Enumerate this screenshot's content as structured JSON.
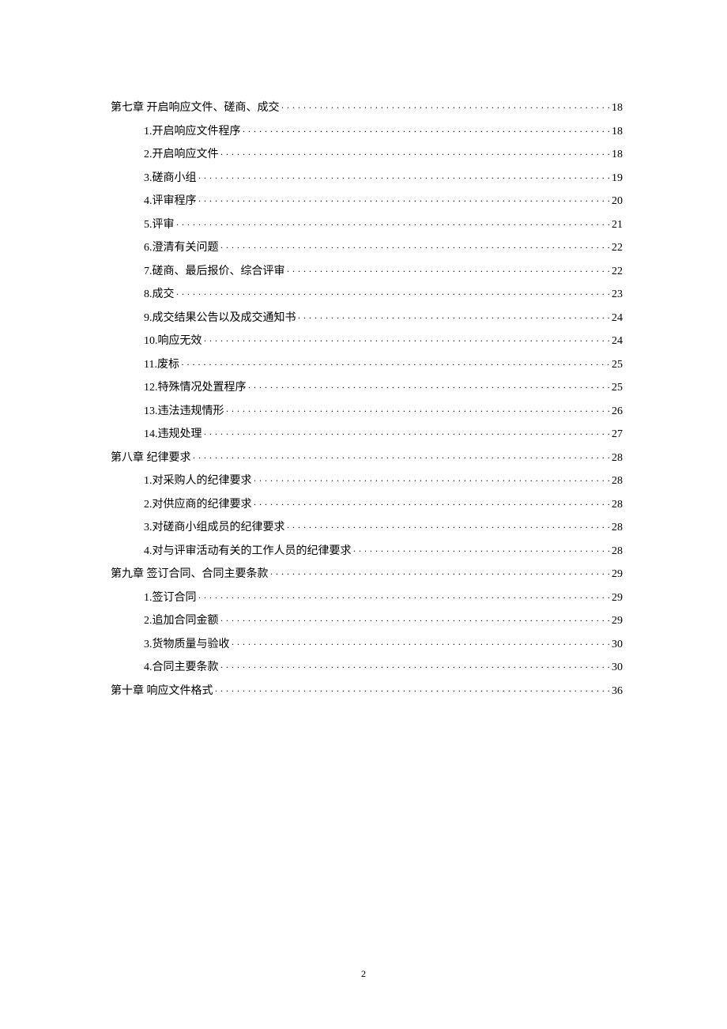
{
  "toc": [
    {
      "type": "chapter",
      "label": "第七章  开启响应文件、磋商、成交",
      "page": "18"
    },
    {
      "type": "section",
      "label": "1.开启响应文件程序",
      "page": "18"
    },
    {
      "type": "section",
      "label": "2.开启响应文件",
      "page": "18"
    },
    {
      "type": "section",
      "label": "3.磋商小组",
      "page": "19"
    },
    {
      "type": "section",
      "label": "4.评审程序",
      "page": "20"
    },
    {
      "type": "section",
      "label": "5.评审",
      "page": "21"
    },
    {
      "type": "section",
      "label": "6.澄清有关问题",
      "page": "22"
    },
    {
      "type": "section",
      "label": "7.磋商、最后报价、综合评审",
      "page": "22"
    },
    {
      "type": "section",
      "label": "8.成交",
      "page": "23"
    },
    {
      "type": "section",
      "label": "9.成交结果公告以及成交通知书",
      "page": "24"
    },
    {
      "type": "section",
      "label": "10.响应无效",
      "page": "24"
    },
    {
      "type": "section",
      "label": "11.废标",
      "page": "25"
    },
    {
      "type": "section",
      "label": "12.特殊情况处置程序",
      "page": "25"
    },
    {
      "type": "section",
      "label": "13.违法违规情形",
      "page": "26"
    },
    {
      "type": "section",
      "label": "14.违规处理",
      "page": "27"
    },
    {
      "type": "chapter",
      "label": "第八章  纪律要求",
      "page": "28"
    },
    {
      "type": "section",
      "label": "1.对采购人的纪律要求",
      "page": "28"
    },
    {
      "type": "section",
      "label": "2.对供应商的纪律要求",
      "page": "28"
    },
    {
      "type": "section",
      "label": "3.对磋商小组成员的纪律要求",
      "page": "28"
    },
    {
      "type": "section",
      "label": "4.对与评审活动有关的工作人员的纪律要求",
      "page": "28"
    },
    {
      "type": "chapter",
      "label": "第九章  签订合同、合同主要条款",
      "page": "29"
    },
    {
      "type": "section",
      "label": "1.签订合同",
      "page": "29"
    },
    {
      "type": "section",
      "label": "2.追加合同金额",
      "page": "29"
    },
    {
      "type": "section",
      "label": "3.货物质量与验收",
      "page": "30"
    },
    {
      "type": "section",
      "label": "4.合同主要条款",
      "page": "30"
    },
    {
      "type": "chapter",
      "label": "第十章  响应文件格式",
      "page": "36"
    }
  ],
  "pageNumber": "2"
}
